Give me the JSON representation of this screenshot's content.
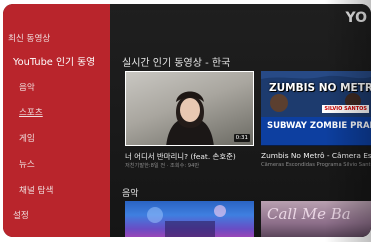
{
  "app": {
    "logo_text": "YO"
  },
  "sidebar": {
    "items": [
      {
        "label": "최신 동영상",
        "active": false
      },
      {
        "label": "YouTube 인기 동영",
        "active": true
      },
      {
        "label": "음악",
        "active": false
      },
      {
        "label": "스포츠",
        "active": false
      },
      {
        "label": "게임",
        "active": false
      },
      {
        "label": "뉴스",
        "active": false
      },
      {
        "label": "채널 탐색",
        "active": false
      },
      {
        "label": "설정",
        "active": false
      }
    ]
  },
  "sections": [
    {
      "title": "실시간 인기 동영상 - 한국",
      "videos": [
        {
          "title": "너 어디서 반마리니? (feat. 손호준)",
          "meta": "저친기말한:8일 전 · 조회수: 94만",
          "duration": "0:31"
        },
        {
          "title": "Zumbis No Metrô - Câmera Escond",
          "meta": "Câmeras Escondidas Programa Silvio Santos",
          "thumb_line1": "ZUMBIS NO METRÔ",
          "thumb_line2": "SUBWAY ZOMBIE PRANK",
          "badge": "SILVIO SANTOS"
        }
      ]
    },
    {
      "title": "음악",
      "videos": [
        {
          "title": "",
          "meta": ""
        },
        {
          "title": "",
          "meta": "",
          "thumb_text": "Call Me Ba"
        }
      ]
    }
  ],
  "colors": {
    "sidebar": "#b9252c",
    "background": "#181818",
    "text": "#f2f2f2"
  }
}
